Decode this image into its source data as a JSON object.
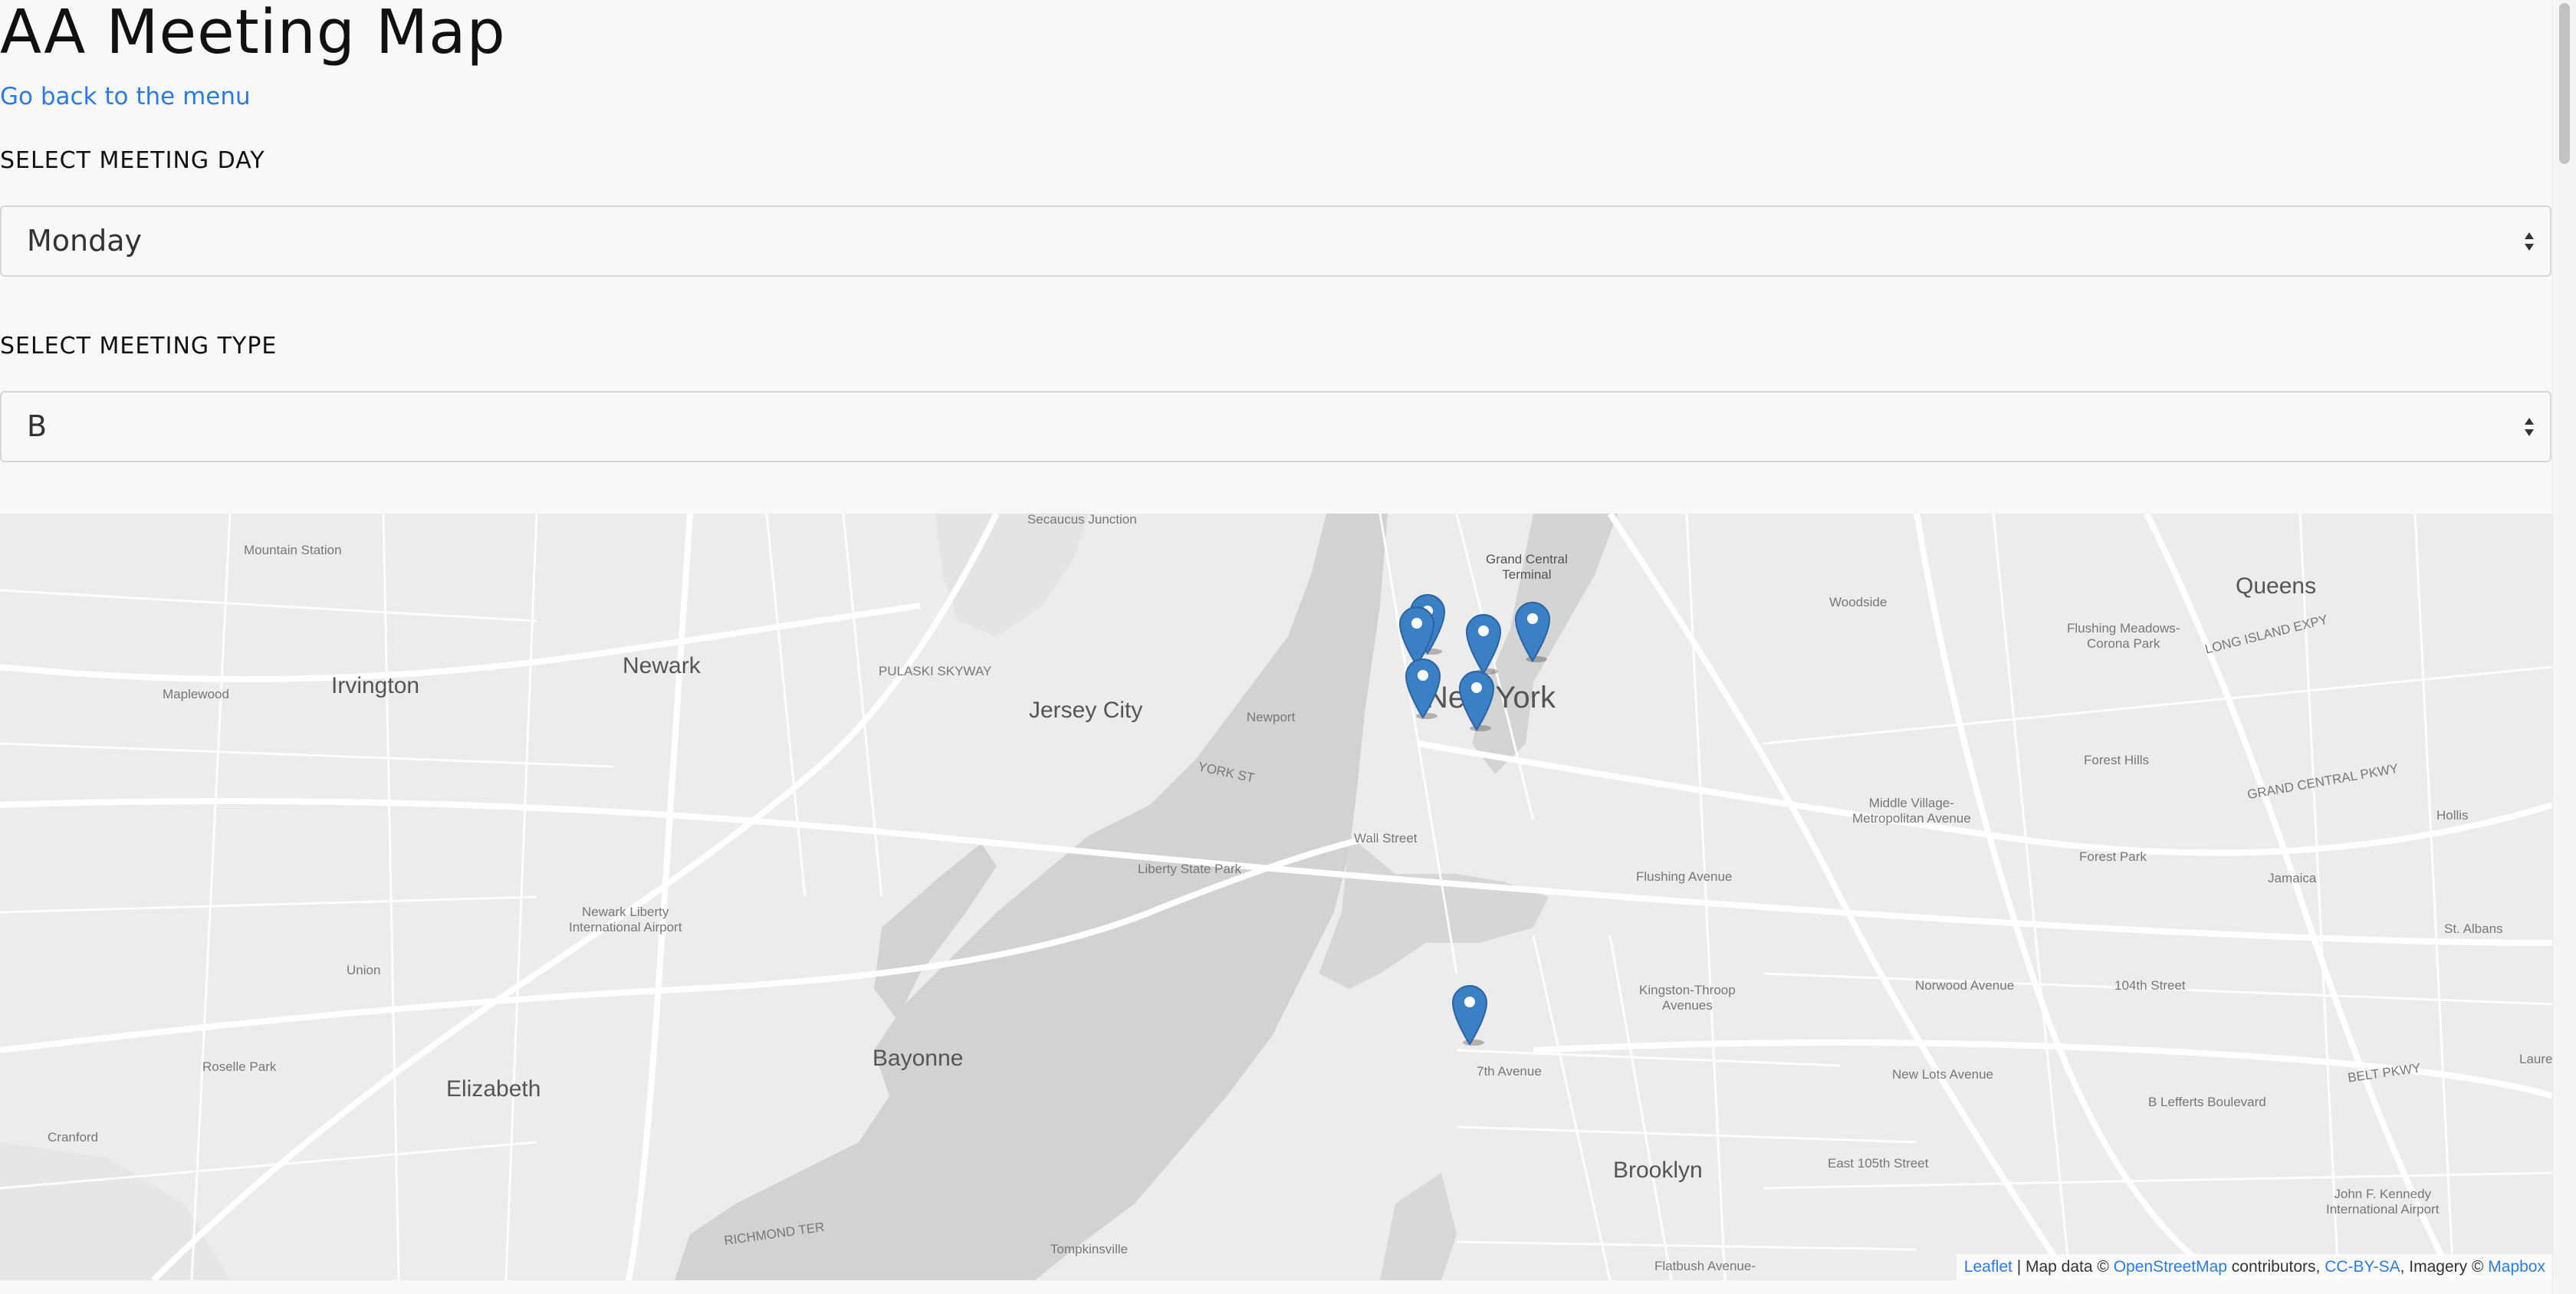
{
  "page": {
    "title": "AA Meeting Map",
    "back_link": "Go back to the menu"
  },
  "filters": {
    "day_label": "SELECT MEETING DAY",
    "day_value": "Monday",
    "type_label": "SELECT MEETING TYPE",
    "type_value": "B"
  },
  "map": {
    "labels": {
      "secaucus": "Secaucus Junction",
      "mountain_station": "Mountain Station",
      "irvington": "Irvington",
      "maplewood": "Maplewood",
      "newark": "Newark",
      "pulaski": "PULASKI SKYWAY",
      "jersey_city": "Jersey City",
      "newport": "Newport",
      "grand_central": "Grand Central\nTerminal",
      "new_york": "New York",
      "woodside": "Woodside",
      "queens": "Queens",
      "flushing_meadows": "Flushing Meadows-\nCorona Park",
      "forest_hills": "Forest Hills",
      "middle_village": "Middle Village-\nMetropolitan Avenue",
      "forest_park": "Forest Park",
      "jamaica": "Jamaica",
      "hollis": "Hollis",
      "st_albans": "St. Albans",
      "wall_street": "Wall Street",
      "liberty_state_park": "Liberty State Park",
      "newark_airport": "Newark Liberty\nInternational Airport",
      "union": "Union",
      "roselle_park": "Roselle Park",
      "elizabeth": "Elizabeth",
      "cranford": "Cranford",
      "bayonne": "Bayonne",
      "seventh_avenue": "7th Avenue",
      "kingston_throop": "Kingston-Throop\nAvenues",
      "norwood": "Norwood Avenue",
      "new_lots": "New Lots Avenue",
      "st104": "104th Street",
      "lefferts": "B Lefferts Boulevard",
      "brooklyn": "Brooklyn",
      "east105": "East 105th Street",
      "jfk": "John F. Kennedy\nInternational Airport",
      "tompkinsville": "Tompkinsville",
      "flatbush": "Flatbush Avenue-",
      "flushing_ave": "Flushing Avenue",
      "laurelton": "Laurelt",
      "grand_central_pkwy": "GRAND CENTRAL PKWY",
      "belt_pkwy": "BELT PKWY",
      "long_island_expy": "LONG ISLAND EXPY",
      "york_st": "YORK ST",
      "richmond_ter": "RICHMOND TER"
    },
    "attribution": {
      "leaflet": "Leaflet",
      "sep1": " | Map data © ",
      "osm": "OpenStreetMap",
      "sep2": " contributors, ",
      "license": "CC-BY-SA",
      "sep3": ", Imagery © ",
      "mapbox": "Mapbox"
    },
    "marker_icon": "map-pin-icon",
    "marker_color": "#3b7fc4"
  },
  "colors": {
    "link": "#2a7be3",
    "background": "#f8f8f8"
  }
}
